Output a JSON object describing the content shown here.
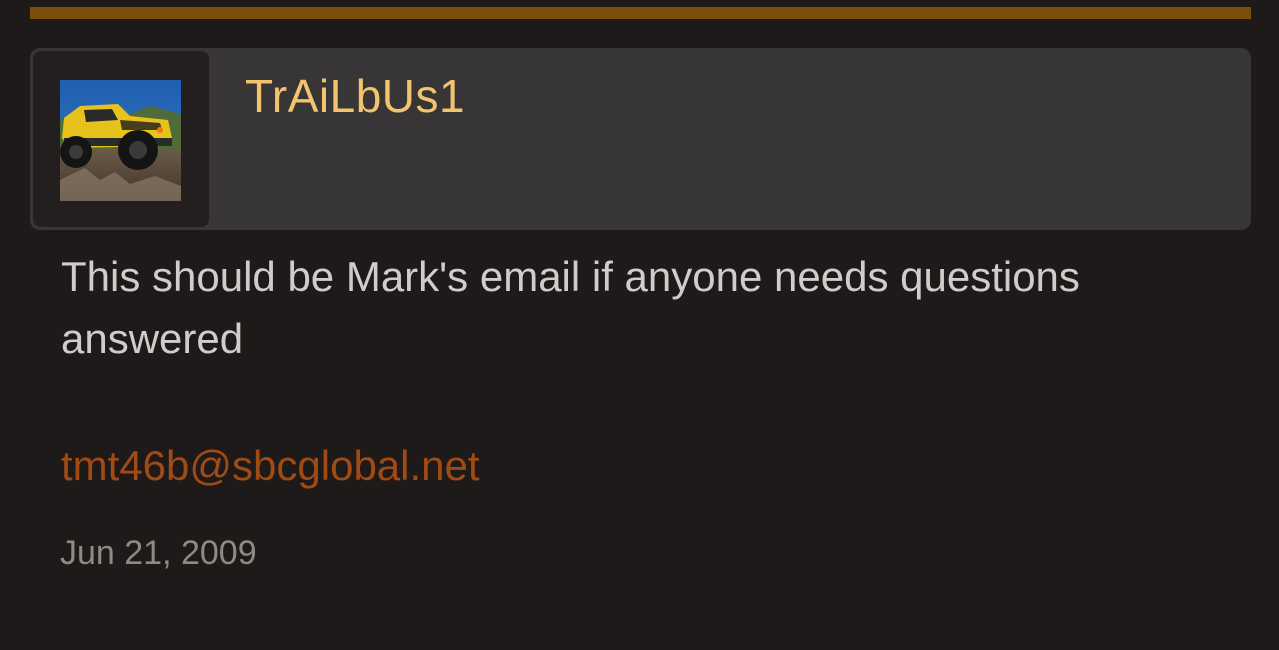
{
  "post": {
    "username": "TrAiLbUs1",
    "avatar_icon": "user-avatar-yellow-fj-cruiser",
    "message": "This should be Mark's email if anyone needs questions answered",
    "email": "tmt46b@sbcglobal.net",
    "date": "Jun 21, 2009"
  },
  "colors": {
    "background": "#1e1a19",
    "header_bg": "#373535",
    "accent_bar": "#7a4f0e",
    "username": "#f3c46e",
    "link": "#a04a14",
    "body_text": "#cfcccb",
    "date_text": "#8f8a88"
  }
}
